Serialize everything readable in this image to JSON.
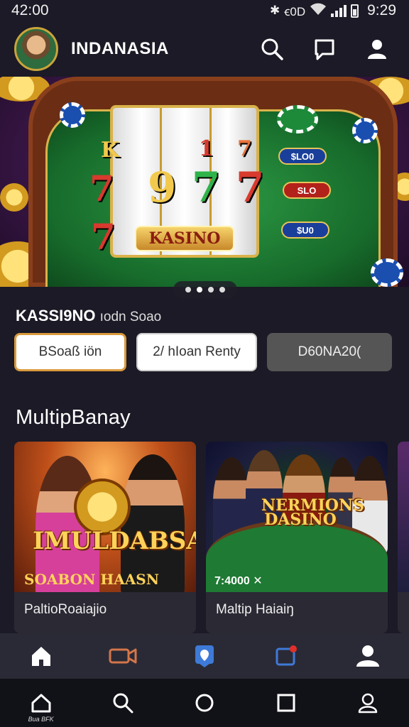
{
  "status_bar": {
    "time_left": "42:00",
    "time_right": "9:29",
    "icons": [
      "bluetooth-icon",
      "nfc-icon",
      "wifi-icon",
      "signal-icon",
      "battery-icon"
    ]
  },
  "header": {
    "app_name": "INDANASIA",
    "icons": [
      "search-icon",
      "chat-icon",
      "profile-icon"
    ]
  },
  "banner": {
    "reel_symbols": [
      "K",
      "1",
      "7",
      "7",
      "9",
      "7",
      "7",
      "7"
    ],
    "center_label": "KASINO",
    "pills": [
      "$LO0",
      "SLO",
      "$U0"
    ],
    "slide_count": 4,
    "active_slide": 2
  },
  "section": {
    "bold": "KASSI9NO",
    "rest": "ıodn Soao"
  },
  "filters": [
    "BSoaß iön",
    "2/ hIoan Renty",
    "D60NA20("
  ],
  "multip": {
    "title": "MultipBanay"
  },
  "cards": [
    {
      "image_text": "IMULDABSA!",
      "image_subtext": "SOABON HAASN",
      "name": "PaltioRoaiajio"
    },
    {
      "image_text": "NERMIONS DASINO",
      "image_subtext": "7:4000 ✕",
      "name": "Maltip Haiaiŋ"
    }
  ],
  "bottom_nav": [
    "home-icon",
    "video-icon",
    "map-pin-icon",
    "notification-icon",
    "user-icon"
  ],
  "system_nav": {
    "home_caption": "Bua BFK"
  },
  "colors": {
    "background": "#1b1a26",
    "accent": "#d99a3d",
    "felt": "#2d9b44"
  }
}
